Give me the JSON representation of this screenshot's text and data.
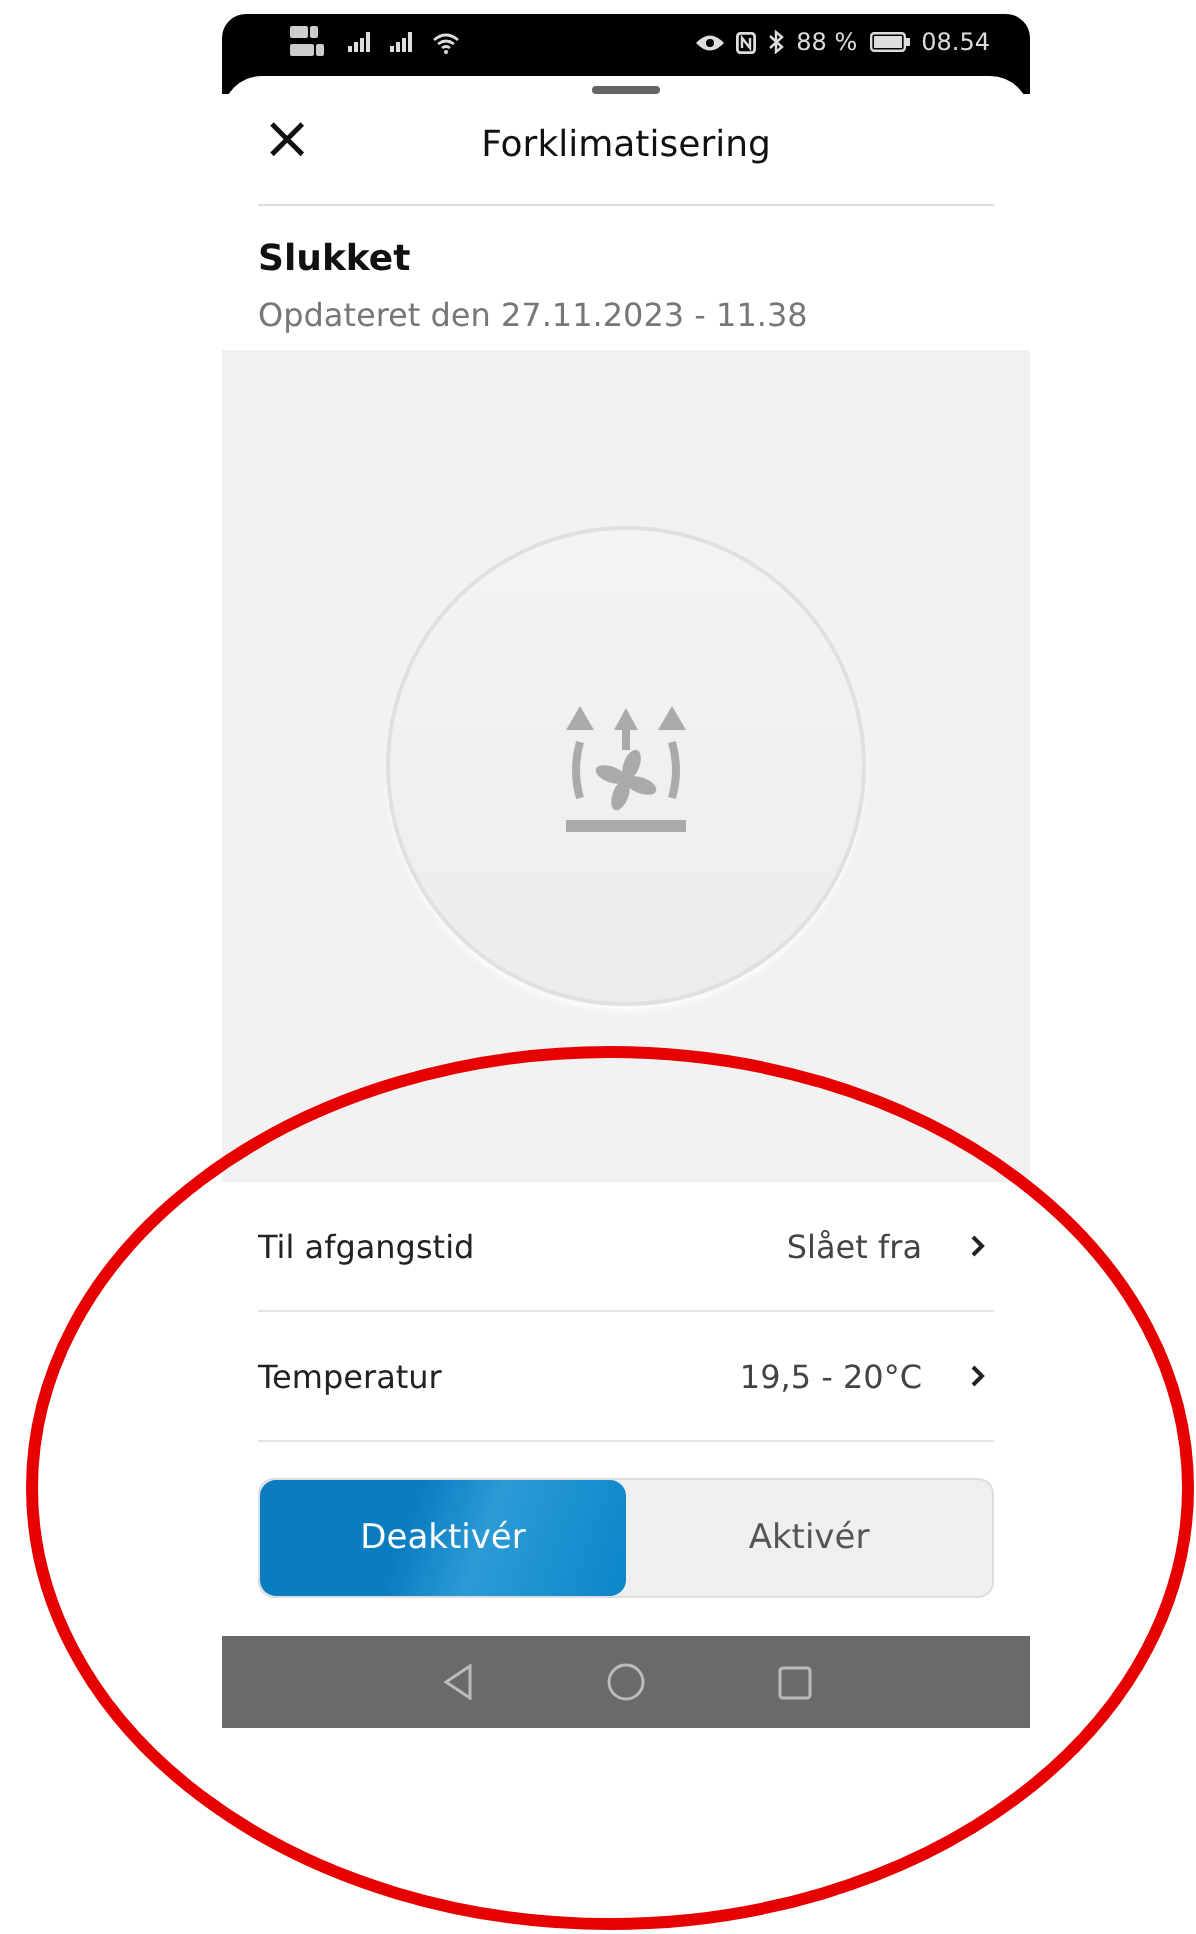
{
  "status_bar": {
    "battery": "88 %",
    "time": "08.54"
  },
  "header": {
    "close": "×",
    "title": "Forklimatisering"
  },
  "state": {
    "title": "Slukket",
    "updated": "Opdateret den 27.11.2023 - 11.38"
  },
  "settings": [
    {
      "label": "Til afgangstid",
      "value": "Slået fra"
    },
    {
      "label": "Temperatur",
      "value": "19,5 - 20°C"
    }
  ],
  "toggle": [
    {
      "label": "Deaktivér",
      "selected": true
    },
    {
      "label": "Aktivér",
      "selected": false
    }
  ]
}
